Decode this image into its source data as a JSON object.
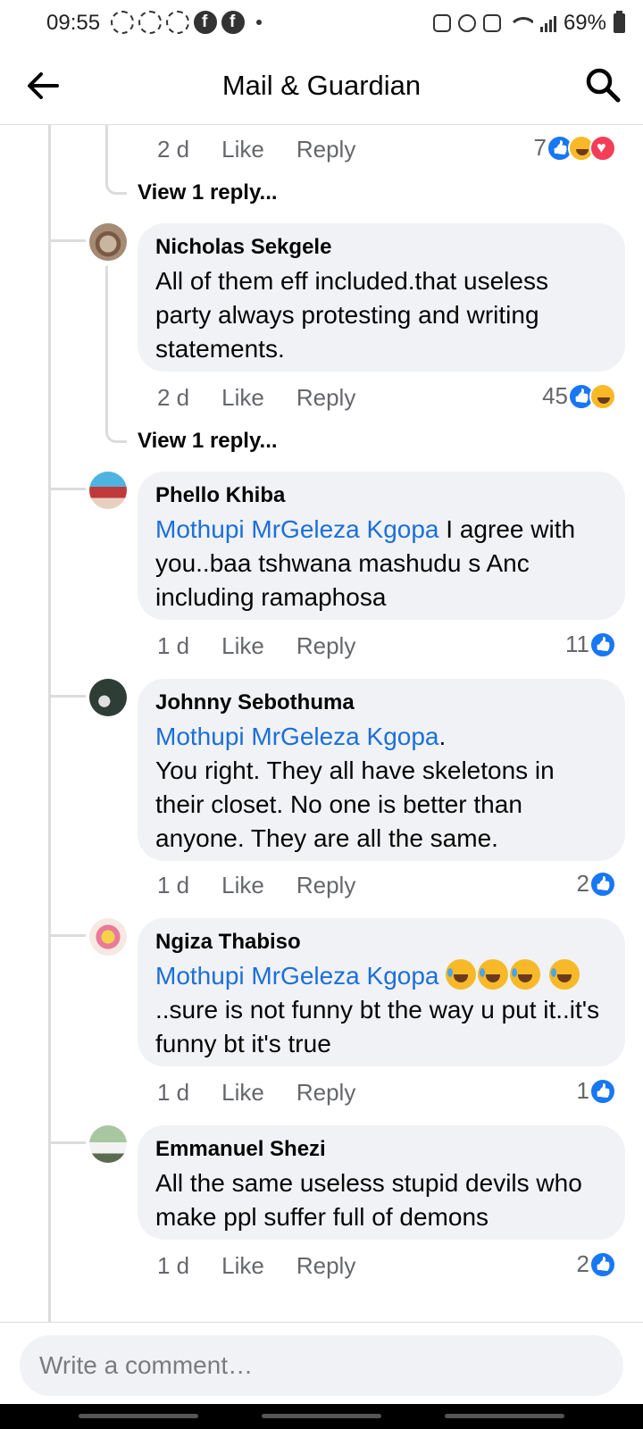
{
  "status_bar": {
    "time": "09:55",
    "battery": "69%"
  },
  "header": {
    "title": "Mail & Guardian"
  },
  "view_replies_label": "View 1 reply...",
  "comments": [
    {
      "id": "prev",
      "time": "2 d",
      "like": "Like",
      "reply": "Reply",
      "reaction_count": "7",
      "reactions": [
        "like",
        "haha",
        "love"
      ]
    },
    {
      "id": "c1",
      "author": "Nicholas Sekgele",
      "text": "All of them eff included.that  useless party always protesting and writing statements.",
      "time": "2 d",
      "like": "Like",
      "reply": "Reply",
      "reaction_count": "45",
      "reactions": [
        "like",
        "haha"
      ]
    },
    {
      "id": "c2",
      "author": "Phello Khiba",
      "mention": "Mothupi MrGeleza Kgopa",
      "text": " I agree with you..baa tshwana mashudu s Anc including ramaphosa",
      "time": "1 d",
      "like": "Like",
      "reply": "Reply",
      "reaction_count": "11",
      "reactions": [
        "like"
      ]
    },
    {
      "id": "c3",
      "author": "Johnny Sebothuma",
      "mention": "Mothupi MrGeleza Kgopa",
      "text_after_mention": ".",
      "text": "You right. They all have skeletons in their closet. No one is better than anyone. They are all the same.",
      "time": "1 d",
      "like": "Like",
      "reply": "Reply",
      "reaction_count": "2",
      "reactions": [
        "like"
      ]
    },
    {
      "id": "c4",
      "author": "Ngiza Thabiso",
      "mention": "Mothupi MrGeleza Kgopa",
      "text": "..sure is not  funny  bt the way u put it..it's funny  bt it's true",
      "time": "1 d",
      "like": "Like",
      "reply": "Reply",
      "reaction_count": "1",
      "reactions": [
        "like"
      ]
    },
    {
      "id": "c5",
      "author": "Emmanuel Shezi",
      "text": "All  the same useless stupid devils who make ppl suffer full of demons",
      "time": "1 d",
      "like": "Like",
      "reply": "Reply",
      "reaction_count": "2",
      "reactions": [
        "like"
      ]
    }
  ],
  "composer": {
    "placeholder": "Write a comment…"
  },
  "colors": {
    "mention": "#1c6fd8",
    "bubble": "#f0f2f5",
    "like": "#1877f2",
    "haha": "#f7b928",
    "love": "#f33e58"
  }
}
